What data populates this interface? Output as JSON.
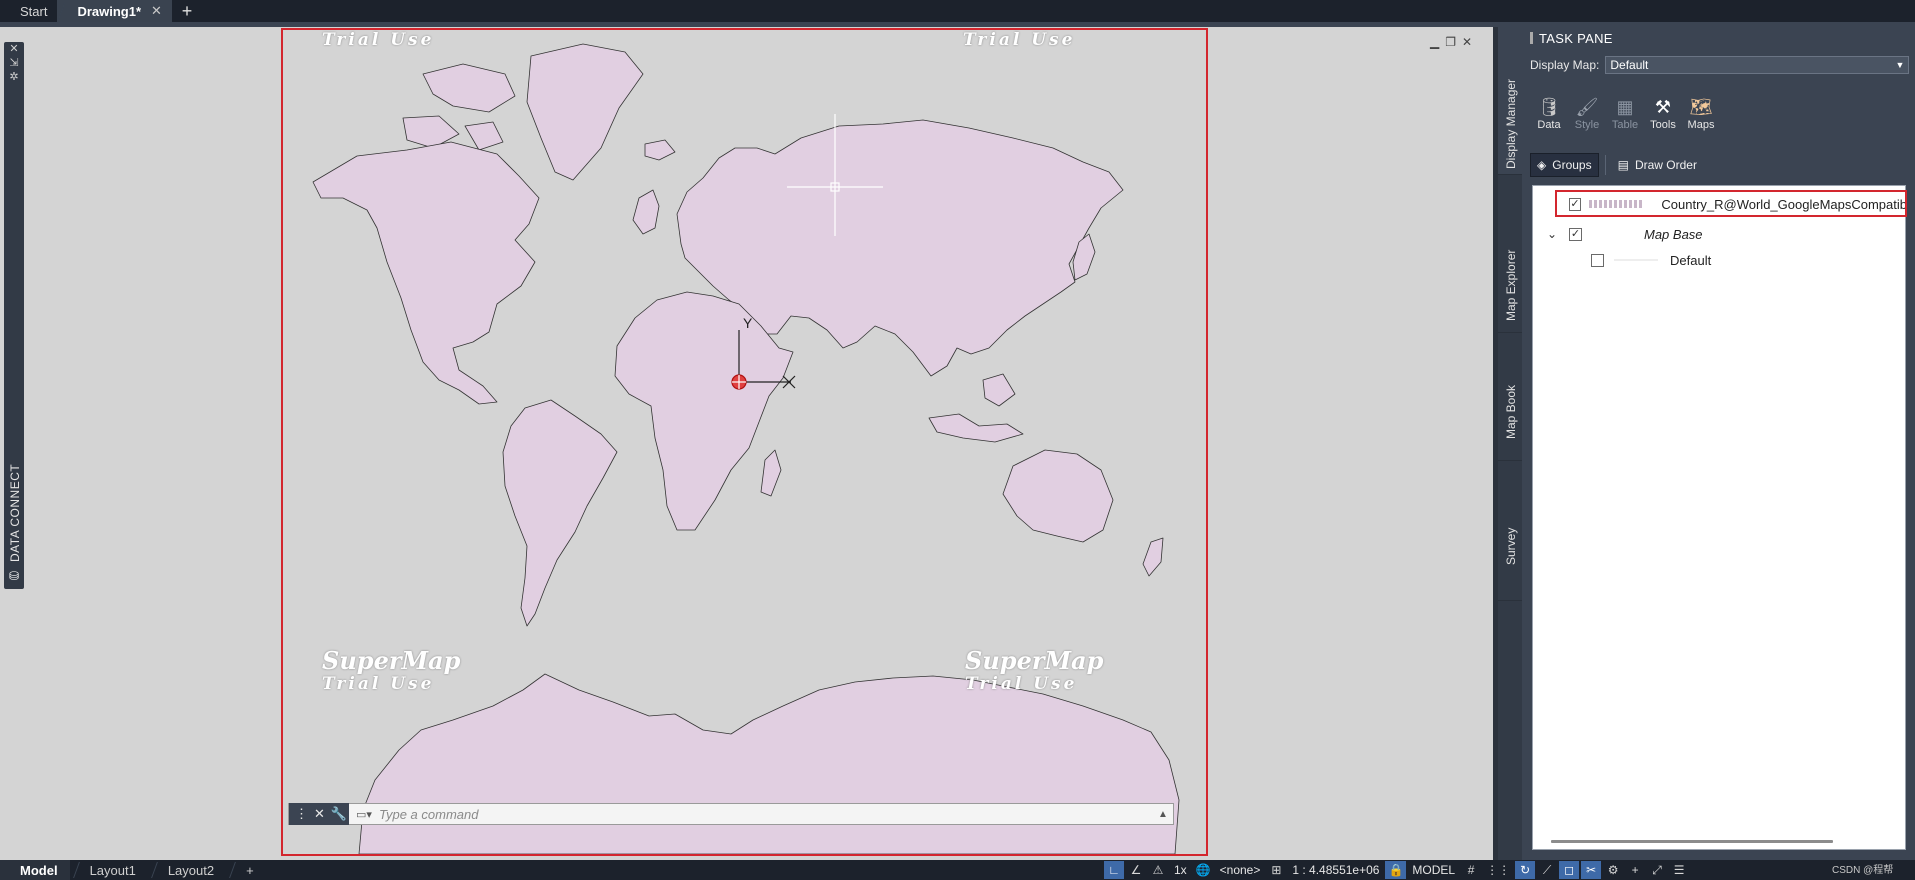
{
  "tabs": {
    "start": "Start",
    "drawing": "Drawing1*",
    "close_glyph": "✕",
    "new_glyph": "+"
  },
  "data_connect": {
    "label": "DATA CONNECT",
    "close_glyph": "✕"
  },
  "map": {
    "watermark_brand": "SuperMap",
    "watermark_trial": "Trial Use",
    "ucs_y": "Y",
    "ucs_x": "X",
    "land_color": "#e1cfe1",
    "outline_color": "#333333"
  },
  "command": {
    "placeholder": "Type a command",
    "close_glyph": "✕",
    "wrench_glyph": "🔧",
    "prompt_glyph": "▭▾",
    "history_glyph": "▲"
  },
  "task_pane": {
    "title": "TASK PANE",
    "vertical_tabs": [
      "Display Manager",
      "Map Explorer",
      "Map Book",
      "Survey"
    ],
    "display_map_label": "Display Map:",
    "display_map_value": "Default",
    "ribbon": [
      {
        "label": "Data",
        "icon": "database-icon",
        "glyph": "🛢",
        "enabled": true
      },
      {
        "label": "Style",
        "icon": "brush-icon",
        "glyph": "🖌",
        "enabled": false
      },
      {
        "label": "Table",
        "icon": "table-icon",
        "glyph": "▦",
        "enabled": false
      },
      {
        "label": "Tools",
        "icon": "tools-icon",
        "glyph": "⚒",
        "enabled": true
      },
      {
        "label": "Maps",
        "icon": "maps-icon",
        "glyph": "🗺",
        "enabled": true
      }
    ],
    "groups_label": "Groups",
    "draw_order_label": "Draw Order",
    "layers": [
      {
        "name": "Country_R@World_GoogleMapsCompatib",
        "checked": true
      },
      {
        "name": "Map Base",
        "checked": true,
        "expanded": true
      },
      {
        "name": "Default",
        "checked": false
      }
    ]
  },
  "status": {
    "layout_tabs": [
      "Model",
      "Layout1",
      "Layout2"
    ],
    "add_glyph": "+",
    "annotation_scale": "1x",
    "coord_system": "<none>",
    "scale": "1 : 4.48551e+06",
    "space": "MODEL",
    "watermark": "CSDN @程帮"
  }
}
